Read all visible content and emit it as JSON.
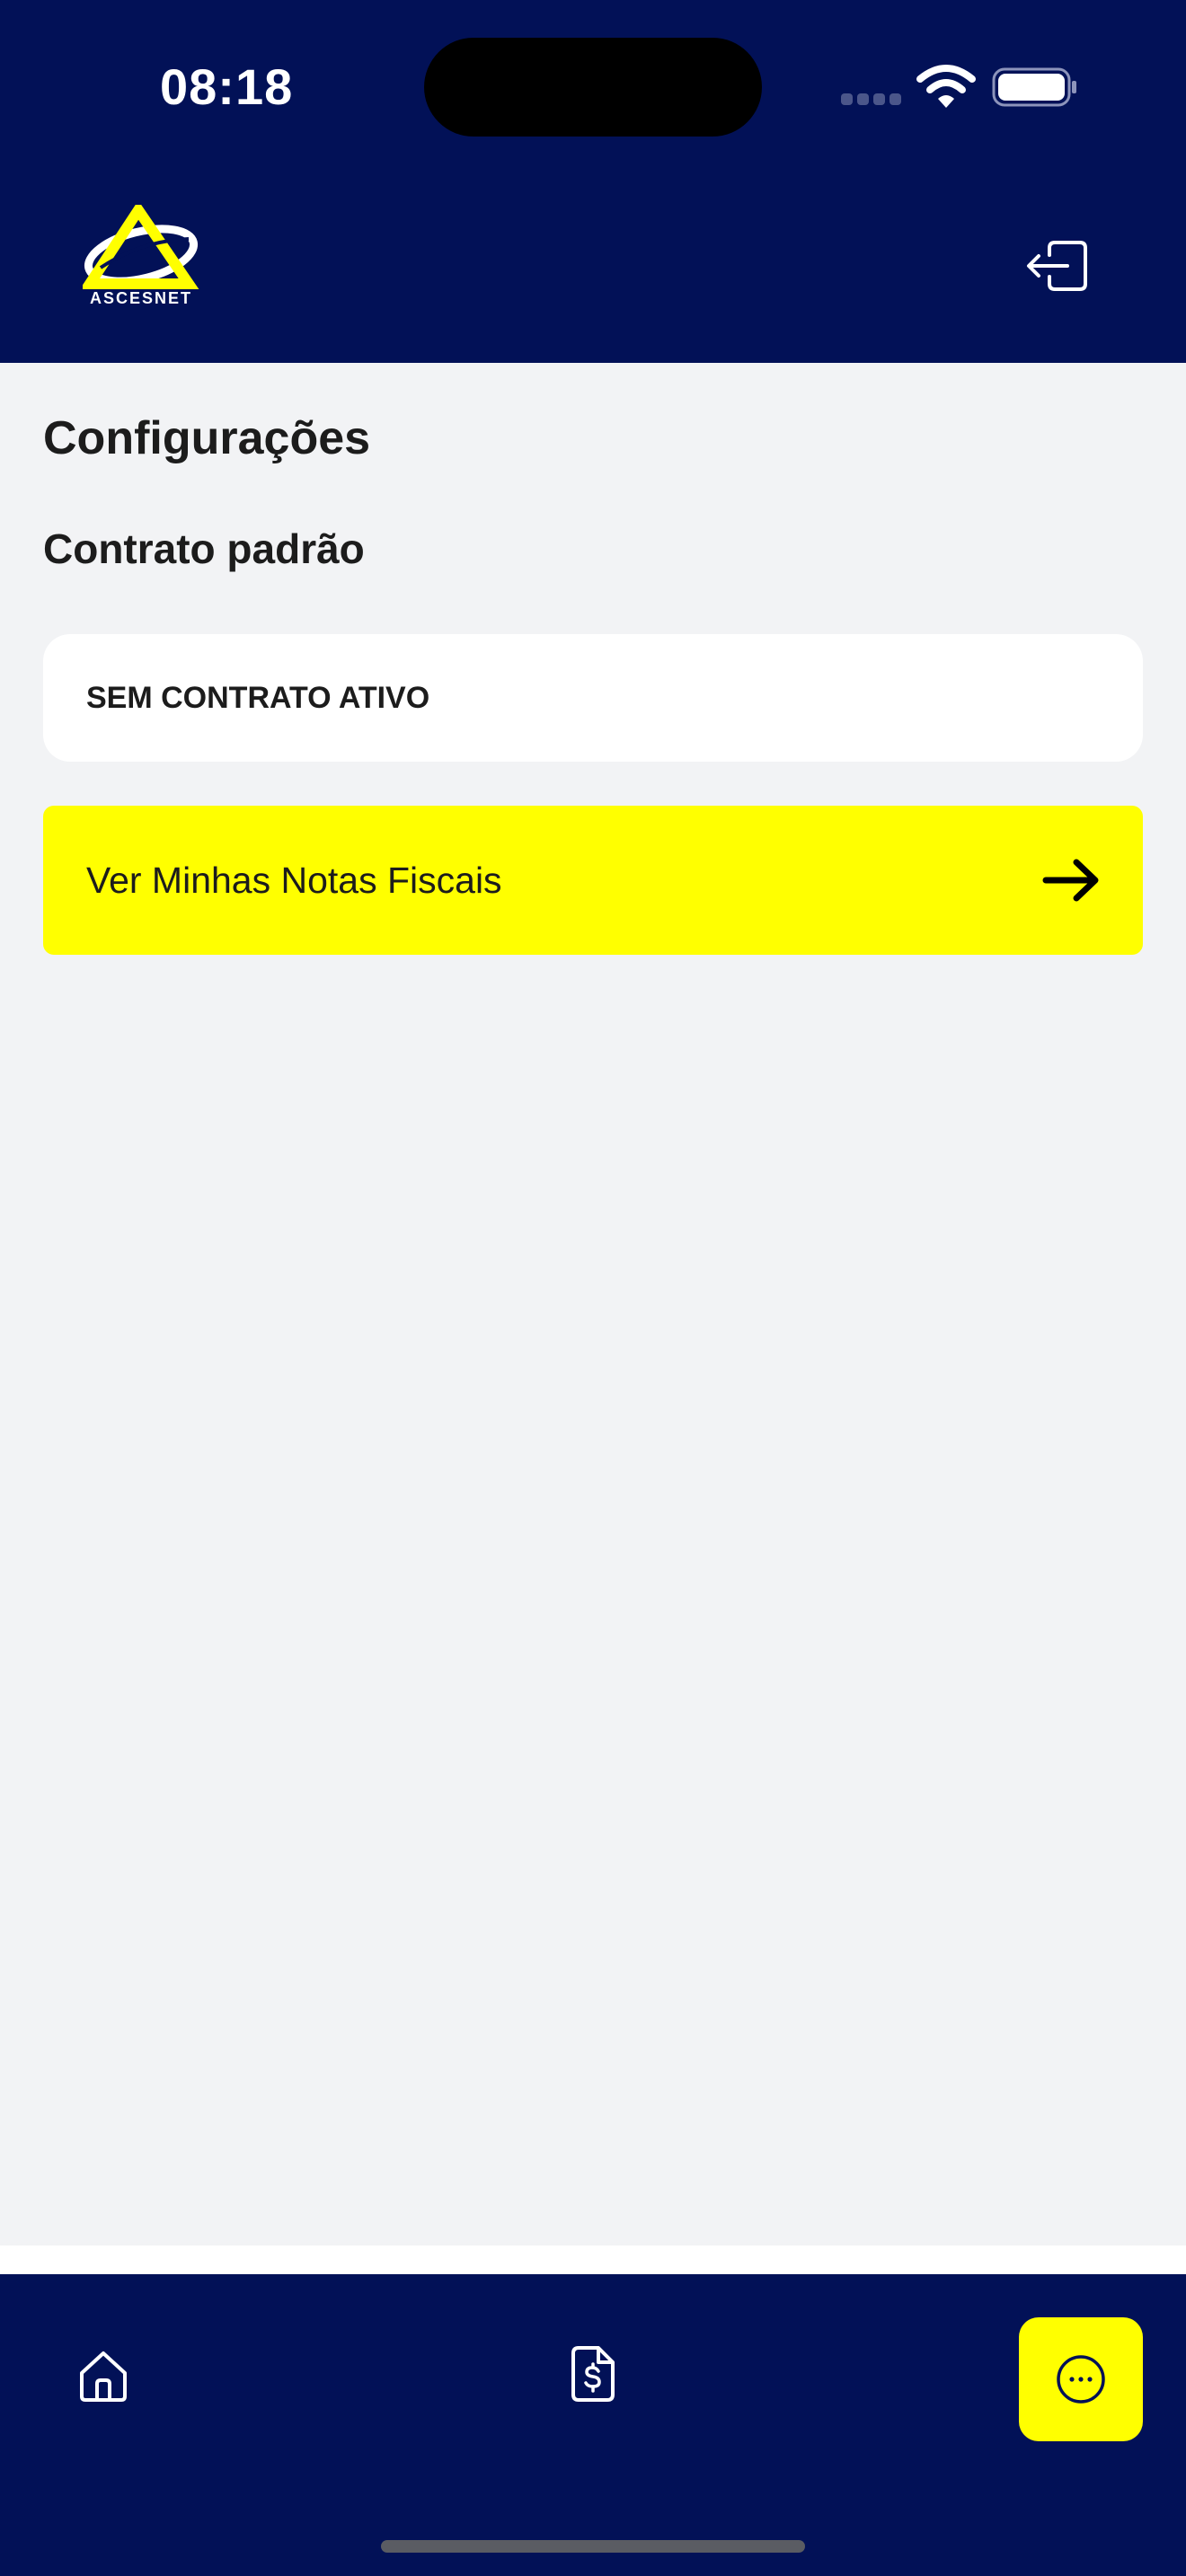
{
  "status_bar": {
    "time": "08:18"
  },
  "header": {
    "logo_text": "ASCESNET",
    "logout_icon": "logout-icon"
  },
  "page": {
    "title": "Configurações",
    "section_title": "Contrato padrão",
    "contract_status": "SEM CONTRATO ATIVO",
    "invoices_button_label": "Ver Minhas Notas Fiscais",
    "invoices_button_icon": "arrow-right-icon"
  },
  "tab_bar": {
    "items": [
      {
        "icon": "home-icon"
      },
      {
        "icon": "invoice-dollar-icon"
      },
      {
        "icon": "chat-icon"
      }
    ]
  },
  "colors": {
    "brand_navy": "#021157",
    "accent_yellow": "#ffff00",
    "background": "#f2f3f5",
    "card": "#ffffff",
    "text": "#1c1c1c"
  }
}
